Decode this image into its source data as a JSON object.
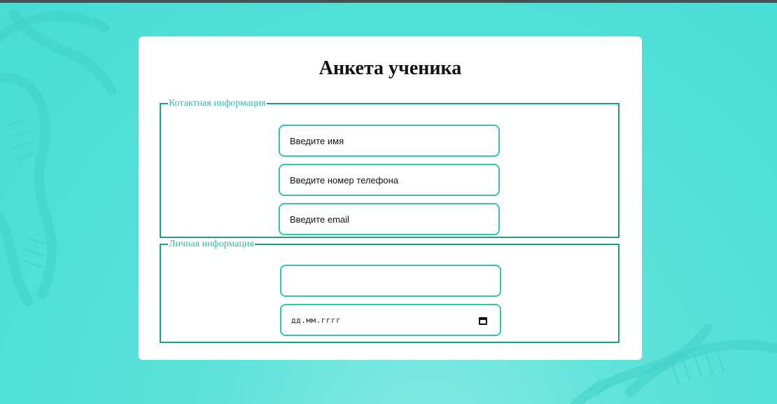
{
  "form": {
    "title": "Анкета ученика",
    "contact_section": {
      "legend": "Котактная информация",
      "name_placeholder": "Введите имя",
      "phone_placeholder": "Введите номер телефона",
      "email_placeholder": "Введите email"
    },
    "personal_section": {
      "legend": "Личная информация",
      "text_value": "",
      "date_placeholder": "дд.мм.гггг",
      "date_icon": "calendar-icon"
    }
  },
  "theme": {
    "background": "#4fe0d6",
    "border": "#1f9c86",
    "input_border": "#33c7a7",
    "legend_color": "#2fbf9f"
  }
}
